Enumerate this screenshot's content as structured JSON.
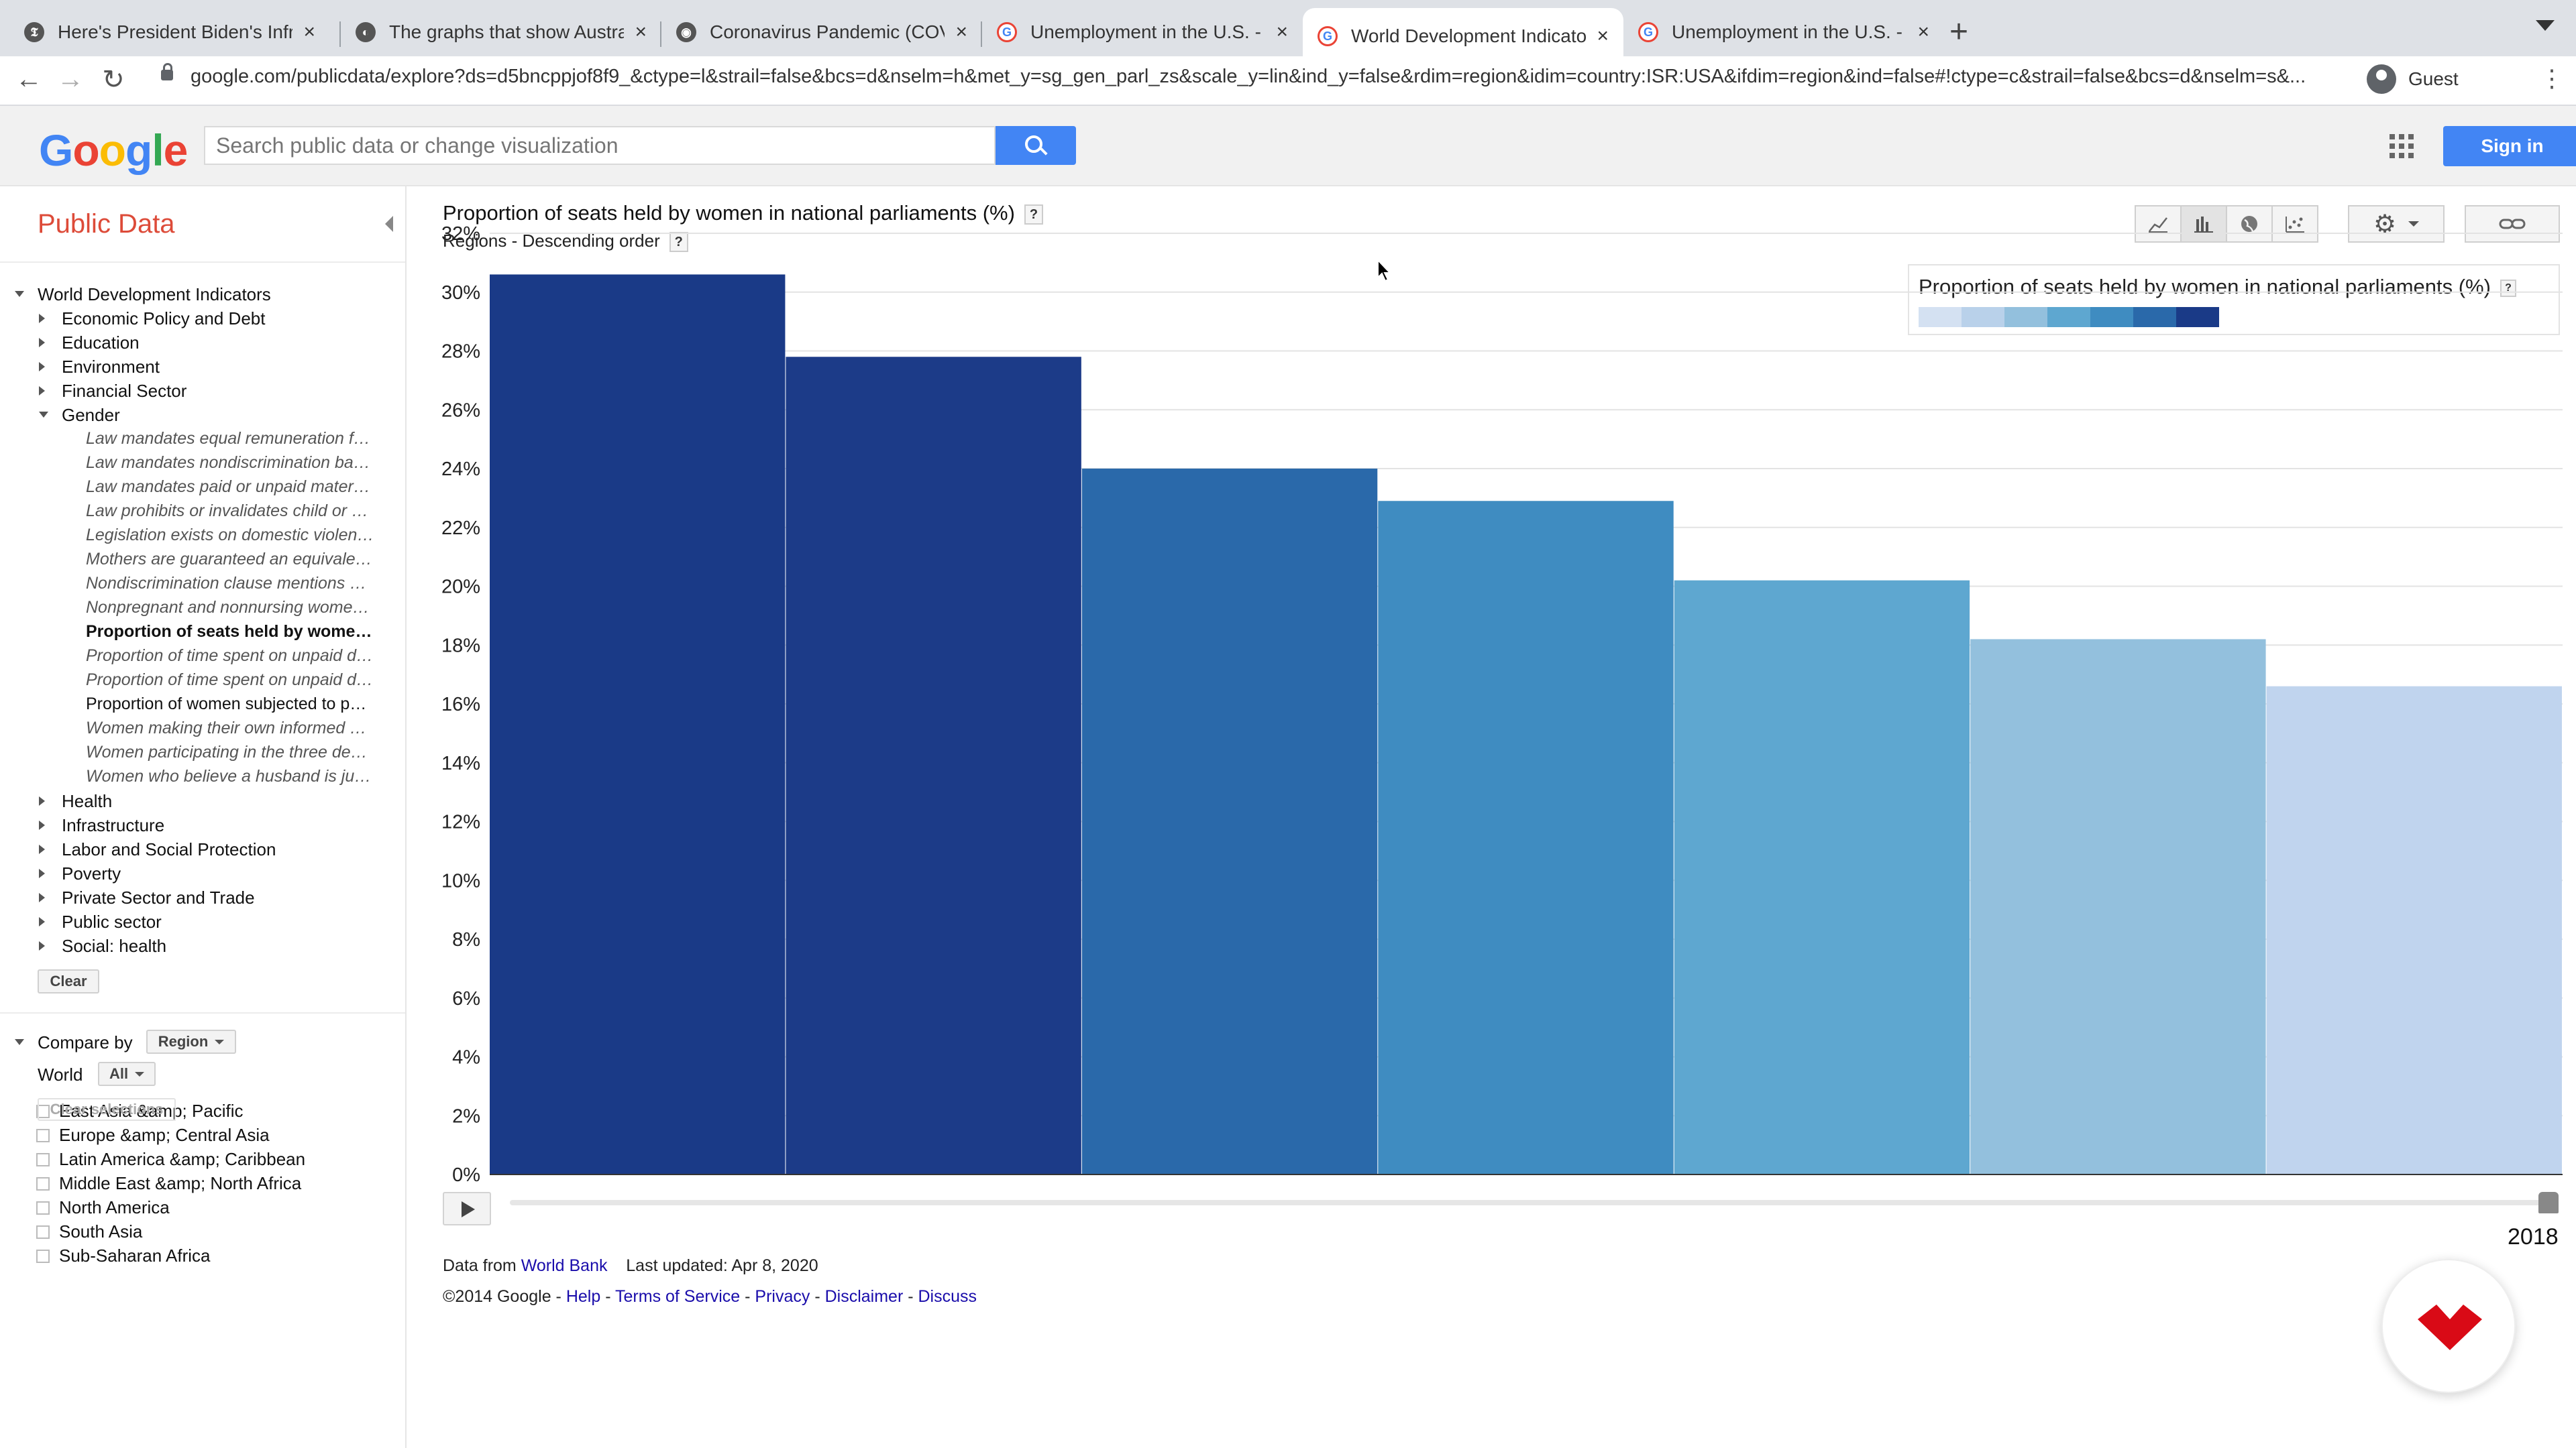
{
  "browser": {
    "tabs": [
      {
        "title": "Here's President Biden's Infras",
        "active": false
      },
      {
        "title": "The graphs that show Australia",
        "active": false
      },
      {
        "title": "Coronavirus Pandemic (COVID",
        "active": false
      },
      {
        "title": "Unemployment in the U.S. - Go",
        "active": false
      },
      {
        "title": "World Development Indicators",
        "active": true
      },
      {
        "title": "Unemployment in the U.S. - Go",
        "active": false
      }
    ],
    "url": "google.com/publicdata/explore?ds=d5bncppjof8f9_&ctype=l&strail=false&bcs=d&nselm=h&met_y=sg_gen_parl_zs&scale_y=lin&ind_y=false&rdim=region&idim=country:ISR:USA&ifdim=region&ind=false#!ctype=c&strail=false&bcs=d&nselm=s&...",
    "profile_label": "Guest"
  },
  "header": {
    "logo": [
      "G",
      "o",
      "o",
      "g",
      "l",
      "e"
    ],
    "search_placeholder": "Search public data or change visualization",
    "signin_label": "Sign in"
  },
  "sidebar": {
    "title": "Public Data",
    "root": "World Development Indicators",
    "categories_before": [
      "Economic Policy and Debt",
      "Education",
      "Environment",
      "Financial Sector"
    ],
    "expanded": "Gender",
    "gender_items": [
      {
        "label": "Law mandates equal remuneration for females and males for work of equal value",
        "style": "italic"
      },
      {
        "label": "Law mandates nondiscrimination based on gender in hiring",
        "style": "italic"
      },
      {
        "label": "Law mandates paid or unpaid maternity leave",
        "style": "italic"
      },
      {
        "label": "Law prohibits or invalidates child or early marriage",
        "style": "italic"
      },
      {
        "label": "Legislation exists on domestic violence",
        "style": "italic"
      },
      {
        "label": "Mothers are guaranteed an equivalent position after maternity leave",
        "style": "italic"
      },
      {
        "label": "Nondiscrimination clause mentions gender in the constitution",
        "style": "italic"
      },
      {
        "label": "Nonpregnant and nonnursing women can do the same jobs as men",
        "style": "italic"
      },
      {
        "label": "Proportion of seats held by women in national parliaments (%)",
        "style": "bold"
      },
      {
        "label": "Proportion of time spent on unpaid domestic and care work, female",
        "style": "italic"
      },
      {
        "label": "Proportion of time spent on unpaid domestic and care work, male",
        "style": "italic"
      },
      {
        "label": "Proportion of women subjected to physical and/or sexual violence",
        "style": "plain"
      },
      {
        "label": "Women making their own informed decisions",
        "style": "italic"
      },
      {
        "label": "Women participating in the three decisions",
        "style": "italic"
      },
      {
        "label": "Women who believe a husband is justified in beating his wife",
        "style": "italic"
      }
    ],
    "categories_after": [
      "Health",
      "Infrastructure",
      "Labor and Social Protection",
      "Poverty",
      "Private Sector and Trade",
      "Public sector",
      "Social: health"
    ],
    "clear_label": "Clear",
    "compare_label": "Compare by",
    "compare_value": "Region",
    "world_label": "World",
    "world_value": "All",
    "regions": [
      "East Asia &amp; Pacific",
      "Europe &amp; Central Asia",
      "Latin America &amp; Caribbean",
      "Middle East &amp; North Africa",
      "North America",
      "South Asia",
      "Sub-Saharan Africa"
    ],
    "clear_selections_label": "Clear selections"
  },
  "main": {
    "title": "Proportion of seats held by women in national parliaments (%)",
    "subtitle": "Regions - Descending order",
    "help_mark": "?",
    "legend_title": "Proportion of seats held by women in national parliaments (%)",
    "legend_colors": [
      "#d4e1f2",
      "#b9d1ea",
      "#93c0dd",
      "#5ea7d0",
      "#3f8cc1",
      "#2a69aa",
      "#1a3a87"
    ],
    "year": "2018",
    "footer_prefix": "Data from",
    "footer_source": "World Bank",
    "footer_updated": "Last updated: Apr 8, 2020",
    "footer_copyright": "©2014 Google -",
    "footer_links": [
      "Help",
      "Terms of Service",
      "Privacy",
      "Disclaimer",
      "Discuss"
    ]
  },
  "chart_data": {
    "type": "bar",
    "title": "Proportion of seats held by women in national parliaments (%)",
    "subtitle": "Regions - Descending order",
    "yticks": [
      "0%",
      "2%",
      "4%",
      "6%",
      "8%",
      "10%",
      "12%",
      "14%",
      "16%",
      "18%",
      "20%",
      "22%",
      "24%",
      "26%",
      "28%",
      "30%",
      "32%"
    ],
    "ylim": [
      0,
      32
    ],
    "grid": true,
    "values": [
      30.6,
      27.8,
      24.0,
      22.9,
      20.2,
      18.2,
      16.6
    ],
    "colors": [
      "#1a3a87",
      "#1c3b88",
      "#2a69aa",
      "#3f8cc1",
      "#5ea7d0",
      "#93c0dd",
      "#c0d4ee"
    ]
  }
}
